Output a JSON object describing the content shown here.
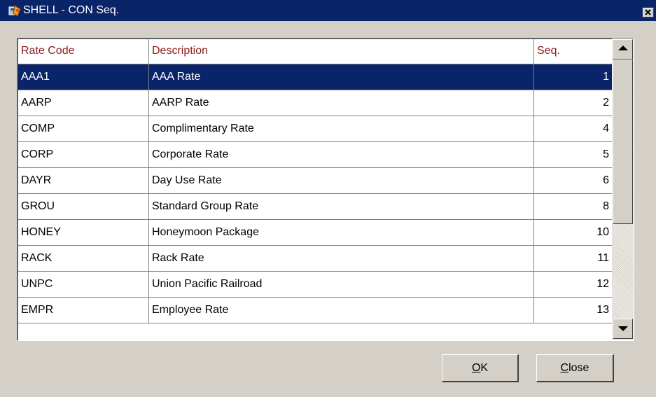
{
  "window": {
    "title": "SHELL - CON Seq.",
    "icon": "app-icon",
    "title_bar_color": "#0a246a"
  },
  "grid": {
    "columns": [
      "Rate Code",
      "Description",
      "Seq."
    ],
    "header_text_color": "#8b1a1a",
    "selected_row_index": 0,
    "selection_color": "#0a246a",
    "rows": [
      {
        "code": "AAA1",
        "description": "AAA Rate",
        "seq": "1"
      },
      {
        "code": "AARP",
        "description": "AARP Rate",
        "seq": "2"
      },
      {
        "code": "COMP",
        "description": "Complimentary Rate",
        "seq": "4"
      },
      {
        "code": "CORP",
        "description": "Corporate Rate",
        "seq": "5"
      },
      {
        "code": "DAYR",
        "description": "Day Use Rate",
        "seq": "6"
      },
      {
        "code": "GROU",
        "description": "Standard Group Rate",
        "seq": "8"
      },
      {
        "code": "HONEY",
        "description": "Honeymoon Package",
        "seq": "10"
      },
      {
        "code": "RACK",
        "description": "Rack Rate",
        "seq": "11"
      },
      {
        "code": "UNPC",
        "description": "Union Pacific Railroad",
        "seq": "12"
      },
      {
        "code": "EMPR",
        "description": "Employee Rate",
        "seq": "13"
      }
    ]
  },
  "buttons": {
    "ok_mnemonic": "O",
    "ok_rest": "K",
    "close_mnemonic": "C",
    "close_rest": "lose"
  }
}
